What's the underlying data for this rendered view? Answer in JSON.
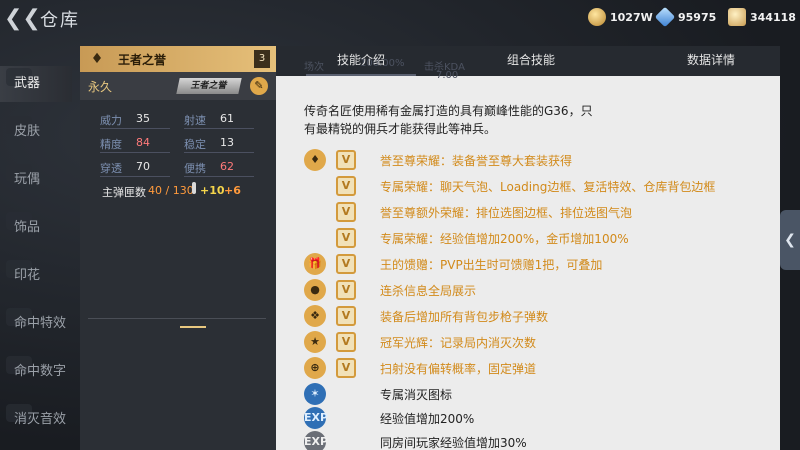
{
  "window": {
    "title": "仓库"
  },
  "currencies": [
    {
      "name": "gold",
      "value": "1027W"
    },
    {
      "name": "diamond",
      "value": "95975"
    },
    {
      "name": "coin",
      "value": "344118"
    }
  ],
  "left_nav": {
    "items": [
      {
        "label": "武器",
        "active": true
      },
      {
        "label": "皮肤",
        "active": false
      },
      {
        "label": "玩偶",
        "active": false
      },
      {
        "label": "饰品",
        "active": false
      },
      {
        "label": "印花",
        "active": false
      },
      {
        "label": "命中特效",
        "active": false
      },
      {
        "label": "命中数字",
        "active": false
      },
      {
        "label": "消灭音效",
        "active": false
      }
    ]
  },
  "weapon_panel": {
    "title": "王者之誉",
    "count": "3",
    "durability": "永久",
    "badge": "王者之誉",
    "stats": [
      {
        "label": "威力",
        "value": "35",
        "highlight": false
      },
      {
        "label": "射速",
        "value": "61",
        "highlight": false
      },
      {
        "label": "精度",
        "value": "84",
        "highlight": true
      },
      {
        "label": "稳定",
        "value": "13",
        "highlight": false
      },
      {
        "label": "穿透",
        "value": "70",
        "highlight": false
      },
      {
        "label": "便携",
        "value": "62",
        "highlight": true
      }
    ],
    "ammo": {
      "label": "主弹匣数",
      "value": "40 / 130",
      "plus_a": "+10",
      "plus_b": "+6"
    }
  },
  "detail": {
    "tabs": [
      "技能介绍",
      "组合技能",
      "数据详情"
    ],
    "tab_ghost": [
      "场次",
      "100.00%",
      "击杀KDA",
      "7.00"
    ],
    "description": "传奇名匠使用稀有金属打造的具有巅峰性能的G36，只有最精锐的佣兵才能获得此等神兵。",
    "skills": [
      {
        "icon": "rank-emblem-icon",
        "text": "誉至尊荣耀：装备誉至尊大套装获得",
        "style": "gold"
      },
      {
        "icon": "",
        "text": "专属荣耀：聊天气泡、Loading边框、复活特效、仓库背包边框",
        "style": "gold"
      },
      {
        "icon": "",
        "text": "誉至尊额外荣耀：排位选图边框、排位选图气泡",
        "style": "gold"
      },
      {
        "icon": "",
        "text": "专属荣耀：经验值增加200%，金币增加100%",
        "style": "gold"
      },
      {
        "icon": "gift-icon",
        "text": "王的馈赠：PVP出生时可馈赠1把，可叠加",
        "style": "gold"
      },
      {
        "icon": "kill-broadcast-icon",
        "text": "连杀信息全局展示",
        "style": "gold"
      },
      {
        "icon": "ammo-icon",
        "text": "装备后增加所有背包步枪子弹数",
        "style": "gold"
      },
      {
        "icon": "trophy-icon",
        "text": "冠军光辉：记录局内消灭次数",
        "style": "gold"
      },
      {
        "icon": "crosshair-icon",
        "text": "扫射没有偏转概率，固定弹道",
        "style": "gold"
      },
      {
        "icon": "kill-icon",
        "text": "专属消灭图标",
        "style": "white"
      },
      {
        "icon": "exp-icon",
        "text": "经验值增加200%",
        "style": "white"
      },
      {
        "icon": "exp-icon",
        "text": "同房间玩家经验值增加30%",
        "style": "white"
      }
    ]
  }
}
